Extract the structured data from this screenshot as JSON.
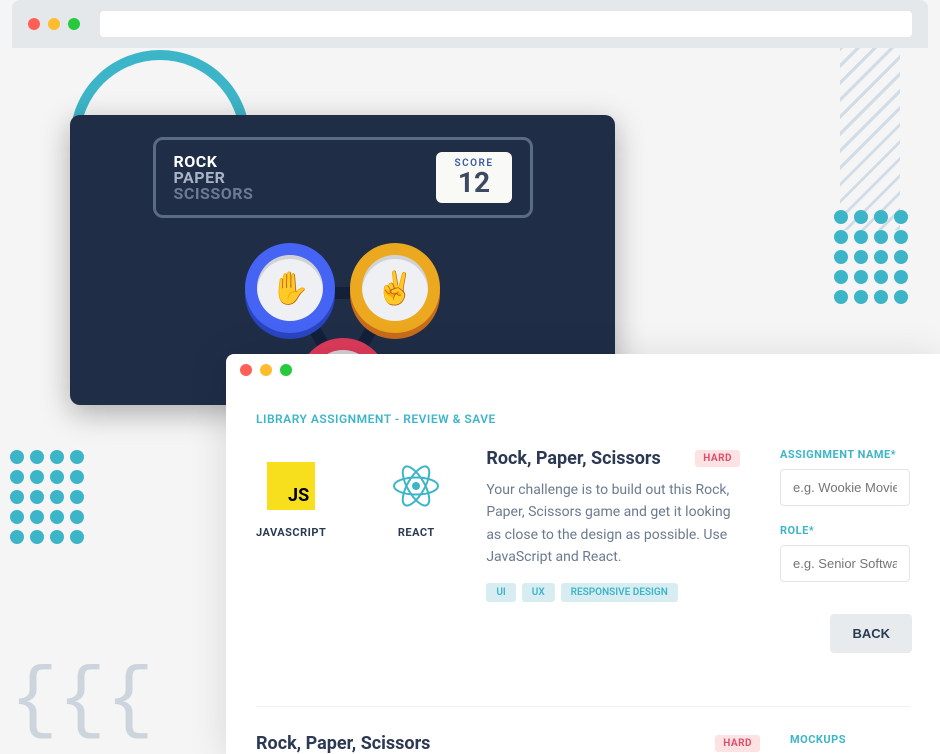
{
  "outer_browser": {
    "url": ""
  },
  "game": {
    "title_line1": "ROCK",
    "title_line2": "PAPER",
    "title_line3": "SCISSORS",
    "score_label": "SCORE",
    "score_value": "12"
  },
  "review": {
    "section_label": "LIBRARY ASSIGNMENT - REVIEW & SAVE",
    "tech": {
      "js_abbr": "JS",
      "js_name": "JAVASCRIPT",
      "react_name": "REACT"
    },
    "title": "Rock, Paper, Scissors",
    "difficulty": "HARD",
    "description": "Your challenge is to build out this Rock, Paper, Scissors game and get it looking as close to the design as possible. Use JavaScript and React.",
    "tags": [
      "UI",
      "UX",
      "RESPONSIVE DESIGN"
    ],
    "form": {
      "assignment_label": "ASSIGNMENT NAME*",
      "assignment_placeholder": "e.g. Wookie Movies",
      "role_label": "ROLE*",
      "role_placeholder": "e.g. Senior Software"
    },
    "back_button": "BACK"
  },
  "second": {
    "title": "Rock, Paper, Scissors",
    "difficulty": "HARD",
    "mockups_label": "MOCKUPS"
  }
}
